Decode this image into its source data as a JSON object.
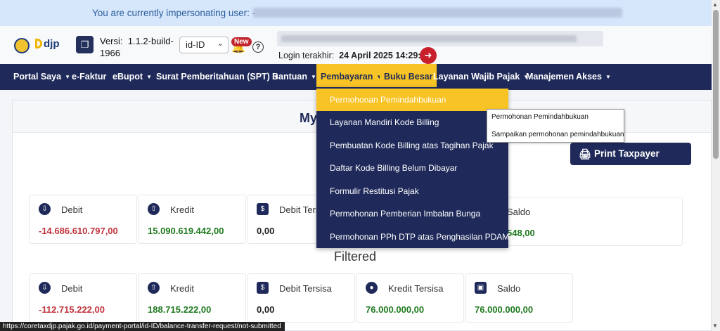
{
  "banner": {
    "text": "You are currently impersonating user: -"
  },
  "header": {
    "logo_text": "djp",
    "version_label": "Versi:",
    "version_value": "1.1.2-build-1966",
    "language": "id-ID",
    "new_badge": "New",
    "help_icon_text": "?",
    "login_label": "Login terakhir:",
    "login_value": "24 April 2025 14:29:24"
  },
  "nav": {
    "items": [
      {
        "label": "Portal Saya",
        "caret": true
      },
      {
        "label": "e-Faktur",
        "caret": false
      },
      {
        "label": "eBupot",
        "caret": true
      },
      {
        "label": "Surat Pemberitahuan (SPT)",
        "caret": true
      },
      {
        "label": "Bantuan",
        "caret": true
      },
      {
        "label": "Pembayaran",
        "caret": true
      },
      {
        "label": "Buku Besar",
        "caret": false
      },
      {
        "label": "Layanan Wajib Pajak",
        "caret": true
      },
      {
        "label": "Manajemen Akses",
        "caret": true
      }
    ]
  },
  "dropdown": {
    "items": [
      "Permohonan Pemindahbukuan",
      "Layanan Mandiri Kode Billing",
      "Pembuatan Kode Billing atas Tagihan Pajak",
      "Daftar Kode Billing Belum Dibayar",
      "Formulir Restitusi Pajak",
      "Permohonan Pemberian Imbalan Bunga",
      "Permohonan PPh DTP atas Penghasilan PDAM"
    ],
    "submenu": [
      "Permohonan Pemindahbukuan",
      "Sampaikan permohonan pemindahbukuan"
    ]
  },
  "main": {
    "title_visible": "My",
    "print_button": "Print Taxpayer Ledger",
    "summary_cards": [
      {
        "label": "Debit",
        "value": "-14.686.610.797,00",
        "color": "#c0343c"
      },
      {
        "label": "Kredit",
        "value": "15.090.619.442,00",
        "color": "#1f7a1f"
      },
      {
        "label": "Debit Tersisa",
        "value": "0,00",
        "color": "#222222"
      },
      {
        "label": "Saldo",
        "value": "548,00",
        "color": "#1f7a1f"
      }
    ],
    "filtered_heading": "Filtered",
    "filtered_cards": [
      {
        "label": "Debit",
        "value": "-112.715.222,00",
        "color": "#c0343c"
      },
      {
        "label": "Kredit",
        "value": "188.715.222,00",
        "color": "#1f7a1f"
      },
      {
        "label": "Debit Tersisa",
        "value": "0,00",
        "color": "#222222"
      },
      {
        "label": "Kredit Tersisa",
        "value": "76.000.000,00",
        "color": "#1f7a1f"
      },
      {
        "label": "Saldo",
        "value": "76.000.000,00",
        "color": "#1f7a1f"
      }
    ]
  },
  "status_url": "https://coretaxdjp.pajak.go.id/payment-portal/id-ID/balance-transfer-request/not-submitted",
  "colors": {
    "navy": "#1f2a5a",
    "accent": "#f7c325",
    "negative": "#c0343c",
    "positive": "#1f7a1f"
  }
}
